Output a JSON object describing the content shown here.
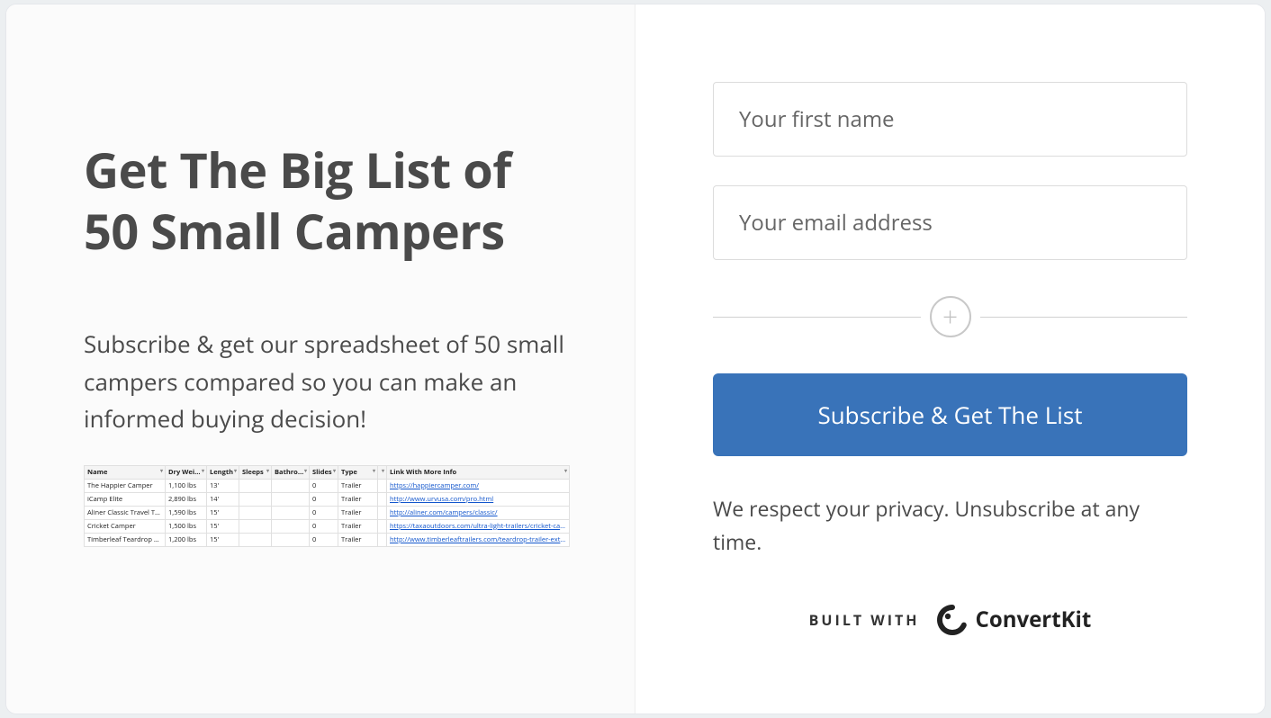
{
  "left": {
    "title": "Get The Big List of 50 Small Campers",
    "subtitle": "Subscribe & get our spreadsheet of 50 small campers compared so you can make an informed buying decision!"
  },
  "spreadsheet": {
    "headers": [
      "Name",
      "Dry Weight",
      "Length",
      "Sleeps",
      "Bathroom",
      "Slides",
      "Type",
      "",
      "Link With More Info"
    ],
    "rows": [
      {
        "name": "The Happier Camper",
        "dry_weight": "1,100 lbs",
        "length": "13'",
        "sleeps": "",
        "bathroom": "",
        "slides": "0",
        "type": "Trailer",
        "blank": "",
        "link": "https://happiercamper.com/"
      },
      {
        "name": "iCamp Elite",
        "dry_weight": "2,890 lbs",
        "length": "14'",
        "sleeps": "",
        "bathroom": "",
        "slides": "0",
        "type": "Trailer",
        "blank": "",
        "link": "http://www.urvusa.com/pro.html"
      },
      {
        "name": "Aliner Classic Travel Trailer",
        "dry_weight": "1,590 lbs",
        "length": "15'",
        "sleeps": "",
        "bathroom": "",
        "slides": "0",
        "type": "Trailer",
        "blank": "",
        "link": "http://aliner.com/campers/classic/"
      },
      {
        "name": "Cricket Camper",
        "dry_weight": "1,500 lbs",
        "length": "15'",
        "sleeps": "",
        "bathroom": "",
        "slides": "0",
        "type": "Trailer",
        "blank": "",
        "link": "https://taxaoutdoors.com/ultra-light-trailers/cricket-camper-trailer/"
      },
      {
        "name": "Timberleaf Teardrop Trailer",
        "dry_weight": "1,200 lbs",
        "length": "15'",
        "sleeps": "",
        "bathroom": "",
        "slides": "0",
        "type": "Trailer",
        "blank": "",
        "link": "http://www.timberleaftrailers.com/teardrop-trailer-exterior/"
      }
    ]
  },
  "form": {
    "first_name_placeholder": "Your first name",
    "email_placeholder": "Your email address",
    "submit_label": "Subscribe & Get The List",
    "privacy_text": "We respect your privacy. Unsubscribe at any time.",
    "built_with_label": "BUILT WITH",
    "provider": "ConvertKit"
  }
}
